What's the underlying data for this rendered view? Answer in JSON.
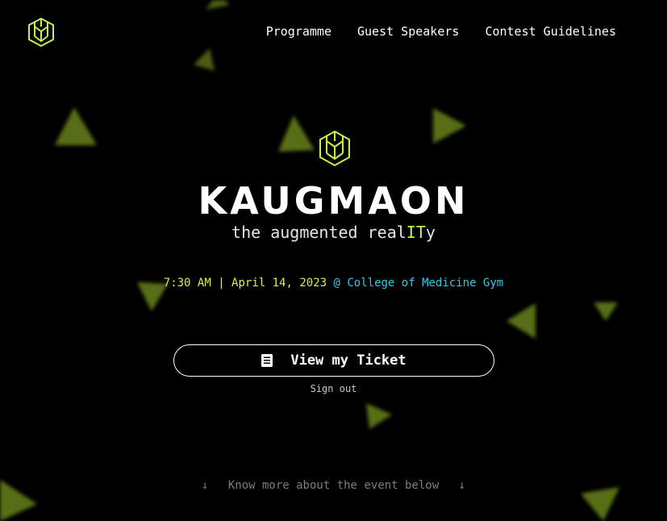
{
  "nav": {
    "logo_icon": "hexagon-cube-logo-icon",
    "items": [
      "Programme",
      "Guest Speakers",
      "Contest Guidelines"
    ]
  },
  "hero": {
    "logo_icon": "hexagon-cube-logo-icon",
    "title": "KAUGMAON",
    "tagline_prefix": "the augmented real",
    "tagline_highlight": "IT",
    "tagline_suffix": "y",
    "time_date": "7:30 AM | April 14, 2023",
    "venue": "@ College of Medicine Gym"
  },
  "actions": {
    "ticket_icon": "ticket-document-icon",
    "ticket_label": "View my Ticket",
    "signout_label": "Sign out"
  },
  "footer": {
    "more_label": "Know more about the event below",
    "arrow_icon": "arrow-down-icon",
    "arrow_glyph": "↓"
  },
  "colors": {
    "background": "#000000",
    "accent_lime": "#c6f24a",
    "accent_cyan": "#38c6e8",
    "triangle": "#6f8a1c"
  }
}
